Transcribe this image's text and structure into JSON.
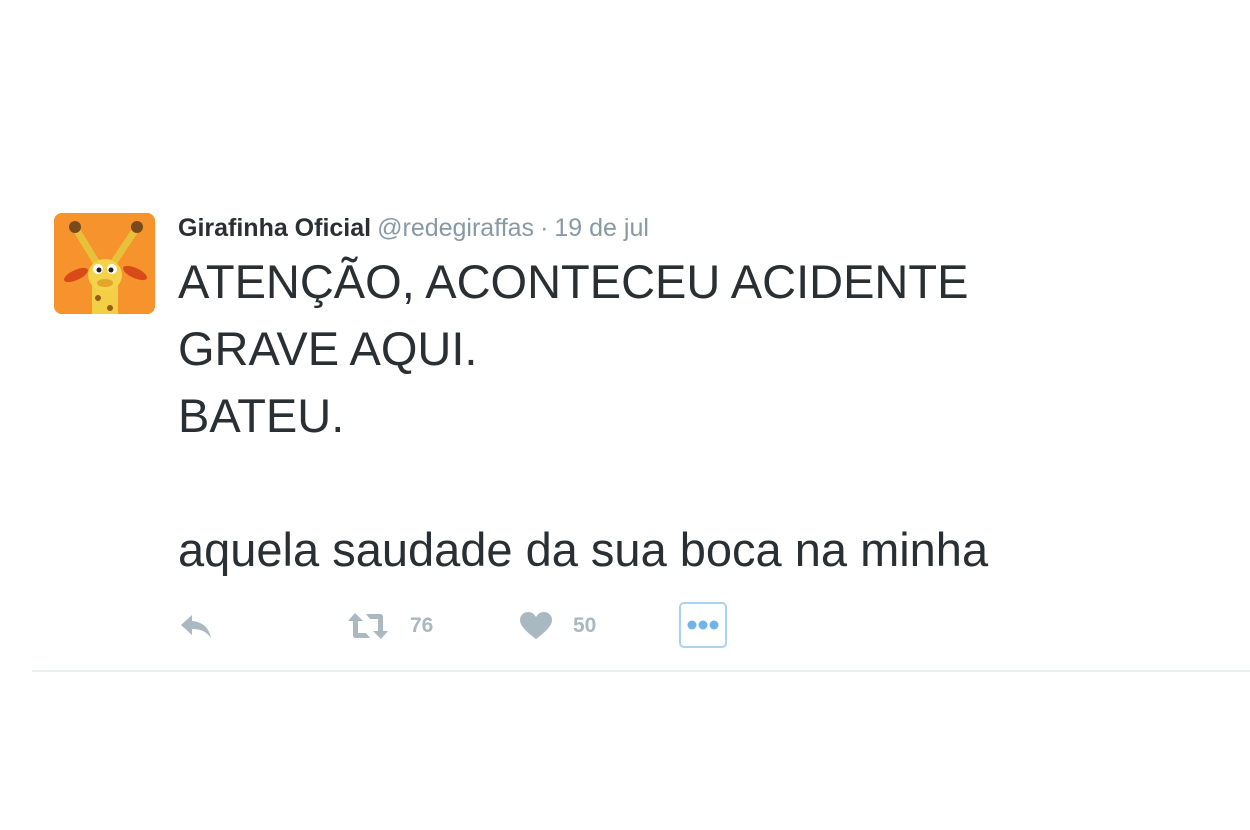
{
  "tweet": {
    "display_name": "Girafinha Oficial",
    "handle": "@redegiraffas",
    "separator": "·",
    "timestamp": "19 de jul",
    "text_lines": [
      "ATENÇÃO, ACONTECEU ACIDENTE",
      "GRAVE AQUI.",
      "BATEU.",
      "aquela saudade da sua boca na minha"
    ],
    "avatar_icon": "giraffe-avatar",
    "avatar_bg": "#f7932c"
  },
  "actions": {
    "reply_icon": "reply-icon",
    "retweet_icon": "retweet-icon",
    "retweet_count": "76",
    "like_icon": "heart-icon",
    "like_count": "50",
    "more_icon": "more-dots-icon"
  },
  "colors": {
    "text": "#292f33",
    "muted": "#8899a6",
    "icon": "#aab8c2",
    "accent": "#aad2f2"
  }
}
